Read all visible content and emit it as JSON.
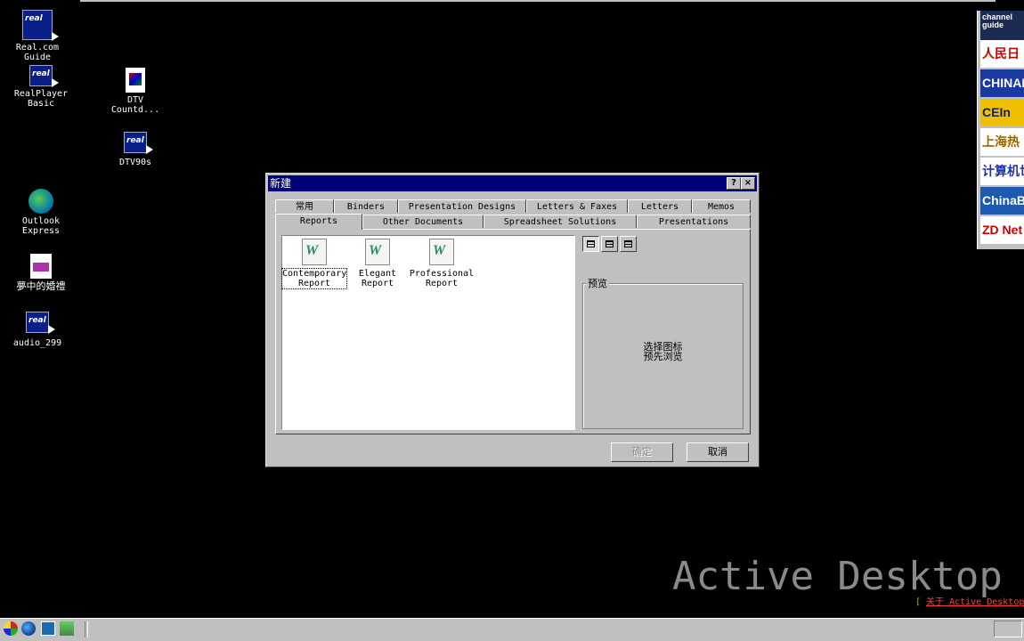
{
  "desktop": {
    "icons": [
      {
        "label": "Real.com\nGuide",
        "icon": "realplayer-icon"
      },
      {
        "label": "RealPlayer\nBasic",
        "icon": "realplayer-icon"
      },
      {
        "label": "DTV\nCountd...",
        "icon": "document-icon"
      },
      {
        "label": "DTV90s",
        "icon": "realplayer-icon"
      },
      {
        "label": "Outlook\nExpress",
        "icon": "outlook-express-icon"
      },
      {
        "label": "夢中的婚禮",
        "icon": "document-icon"
      },
      {
        "label": "audio_299",
        "icon": "realplayer-icon"
      }
    ],
    "watermark": "Active Desktop",
    "about_link": {
      "prefix": "[ ",
      "label": "关于 Active Desktop"
    }
  },
  "channel_bar": {
    "items": [
      {
        "label": "channel\nguide",
        "bg": "#1a2a50",
        "color": "#ffffff"
      },
      {
        "label": "人民日",
        "bg": "#ffffff",
        "color": "#cc0000"
      },
      {
        "label": "CHINAN",
        "bg": "#1a3aa0",
        "color": "#ffffff"
      },
      {
        "label": "CEIn",
        "bg": "#f0c000",
        "color": "#102060"
      },
      {
        "label": "上海热",
        "bg": "#ffffff",
        "color": "#996600"
      },
      {
        "label": "计算机世",
        "bg": "#ffffff",
        "color": "#2233aa"
      },
      {
        "label": "ChinaB",
        "bg": "#1e5ab0",
        "color": "#ffffff"
      },
      {
        "label": "ZD Net",
        "bg": "#ffffff",
        "color": "#cc0000"
      }
    ]
  },
  "dialog": {
    "title": "新建",
    "help_button": "?",
    "close_button": "×",
    "tabs_back": [
      "常用",
      "Binders",
      "Presentation Designs",
      "Letters & Faxes",
      "Letters",
      "Memos"
    ],
    "tabs_front": [
      "Reports",
      "Other Documents",
      "Spreadsheet Solutions",
      "Presentations"
    ],
    "active_tab": "Reports",
    "templates": [
      {
        "line1": "Contemporary",
        "line2": "Report",
        "selected": true
      },
      {
        "line1": "Elegant",
        "line2": "Report",
        "selected": false
      },
      {
        "line1": "Professional",
        "line2": "Report",
        "selected": false
      }
    ],
    "view_buttons": [
      "large-icons-icon",
      "list-view-icon",
      "details-view-icon"
    ],
    "preview_label": "预览",
    "preview_text_line1": "选择图标",
    "preview_text_line2": "预先浏览",
    "ok_button": "确定",
    "cancel_button": "取消"
  },
  "taskbar": {
    "quick_launch": [
      "start-icon",
      "internet-explorer-icon",
      "show-desktop-icon",
      "channels-icon"
    ]
  }
}
